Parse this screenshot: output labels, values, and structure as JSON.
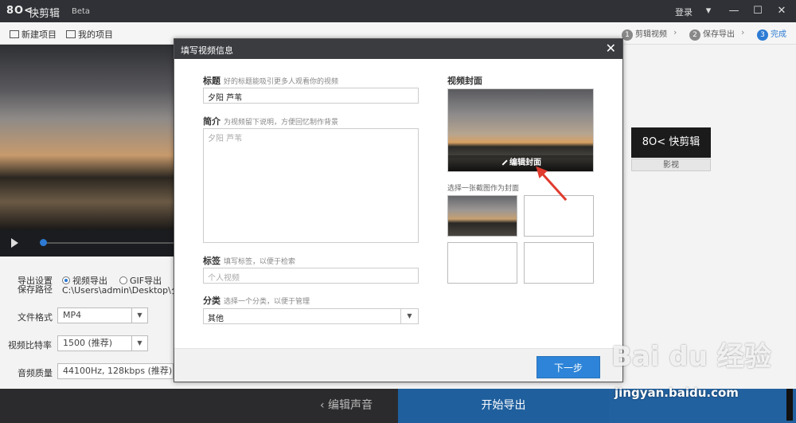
{
  "app": {
    "logo": "8O<",
    "name": "快剪辑",
    "badge": "Beta",
    "login": "登录"
  },
  "toolbar": {
    "new_project": "新建项目",
    "my_projects": "我的项目",
    "steps": [
      {
        "num": "1",
        "label": "剪辑视频"
      },
      {
        "num": "2",
        "label": "保存导出"
      },
      {
        "num": "3",
        "label": "完成"
      }
    ]
  },
  "export_panel": {
    "settings_label": "导出设置",
    "path_label": "保存路径",
    "radio_video": "视频导出",
    "radio_gif": "GIF导出",
    "path_value": "C:\\Users\\admin\\Desktop\\夕阳",
    "format_label": "文件格式",
    "format_value": "MP4",
    "bitrate_label": "视频比特率",
    "bitrate_value": "1500 (推荐)",
    "audio_label": "音频质量",
    "audio_value": "44100Hz, 128kbps (推荐)"
  },
  "brand_card": {
    "logo": "8O< 快剪辑",
    "caption": "影视"
  },
  "bottom": {
    "back_label": "编辑声音",
    "start_label": "开始导出"
  },
  "dialog": {
    "title": "填写视频信息",
    "close": "✕",
    "title_label": "标题",
    "title_hint": "好的标题能吸引更多人观看你的视频",
    "title_value": "夕阳 芦苇",
    "intro_label": "简介",
    "intro_hint": "为视频留下说明，方便回忆制作背景",
    "intro_value": "夕阳 芦苇",
    "tags_label": "标签",
    "tags_hint": "填写标签，以便于检索",
    "tags_placeholder": "个人视频",
    "category_label": "分类",
    "category_hint": "选择一个分类，以便于管理",
    "category_value": "其他",
    "cover_title": "视频封面",
    "cover_edit": "编辑封面",
    "cover_choose": "选择一张截图作为封面",
    "next_button": "下一步"
  },
  "watermark": {
    "main": "Bai du 经验",
    "sub": "jingyan.baidu.com"
  },
  "colors": {
    "accent": "#2d84d8",
    "annotation_arrow": "#e03b2e"
  }
}
